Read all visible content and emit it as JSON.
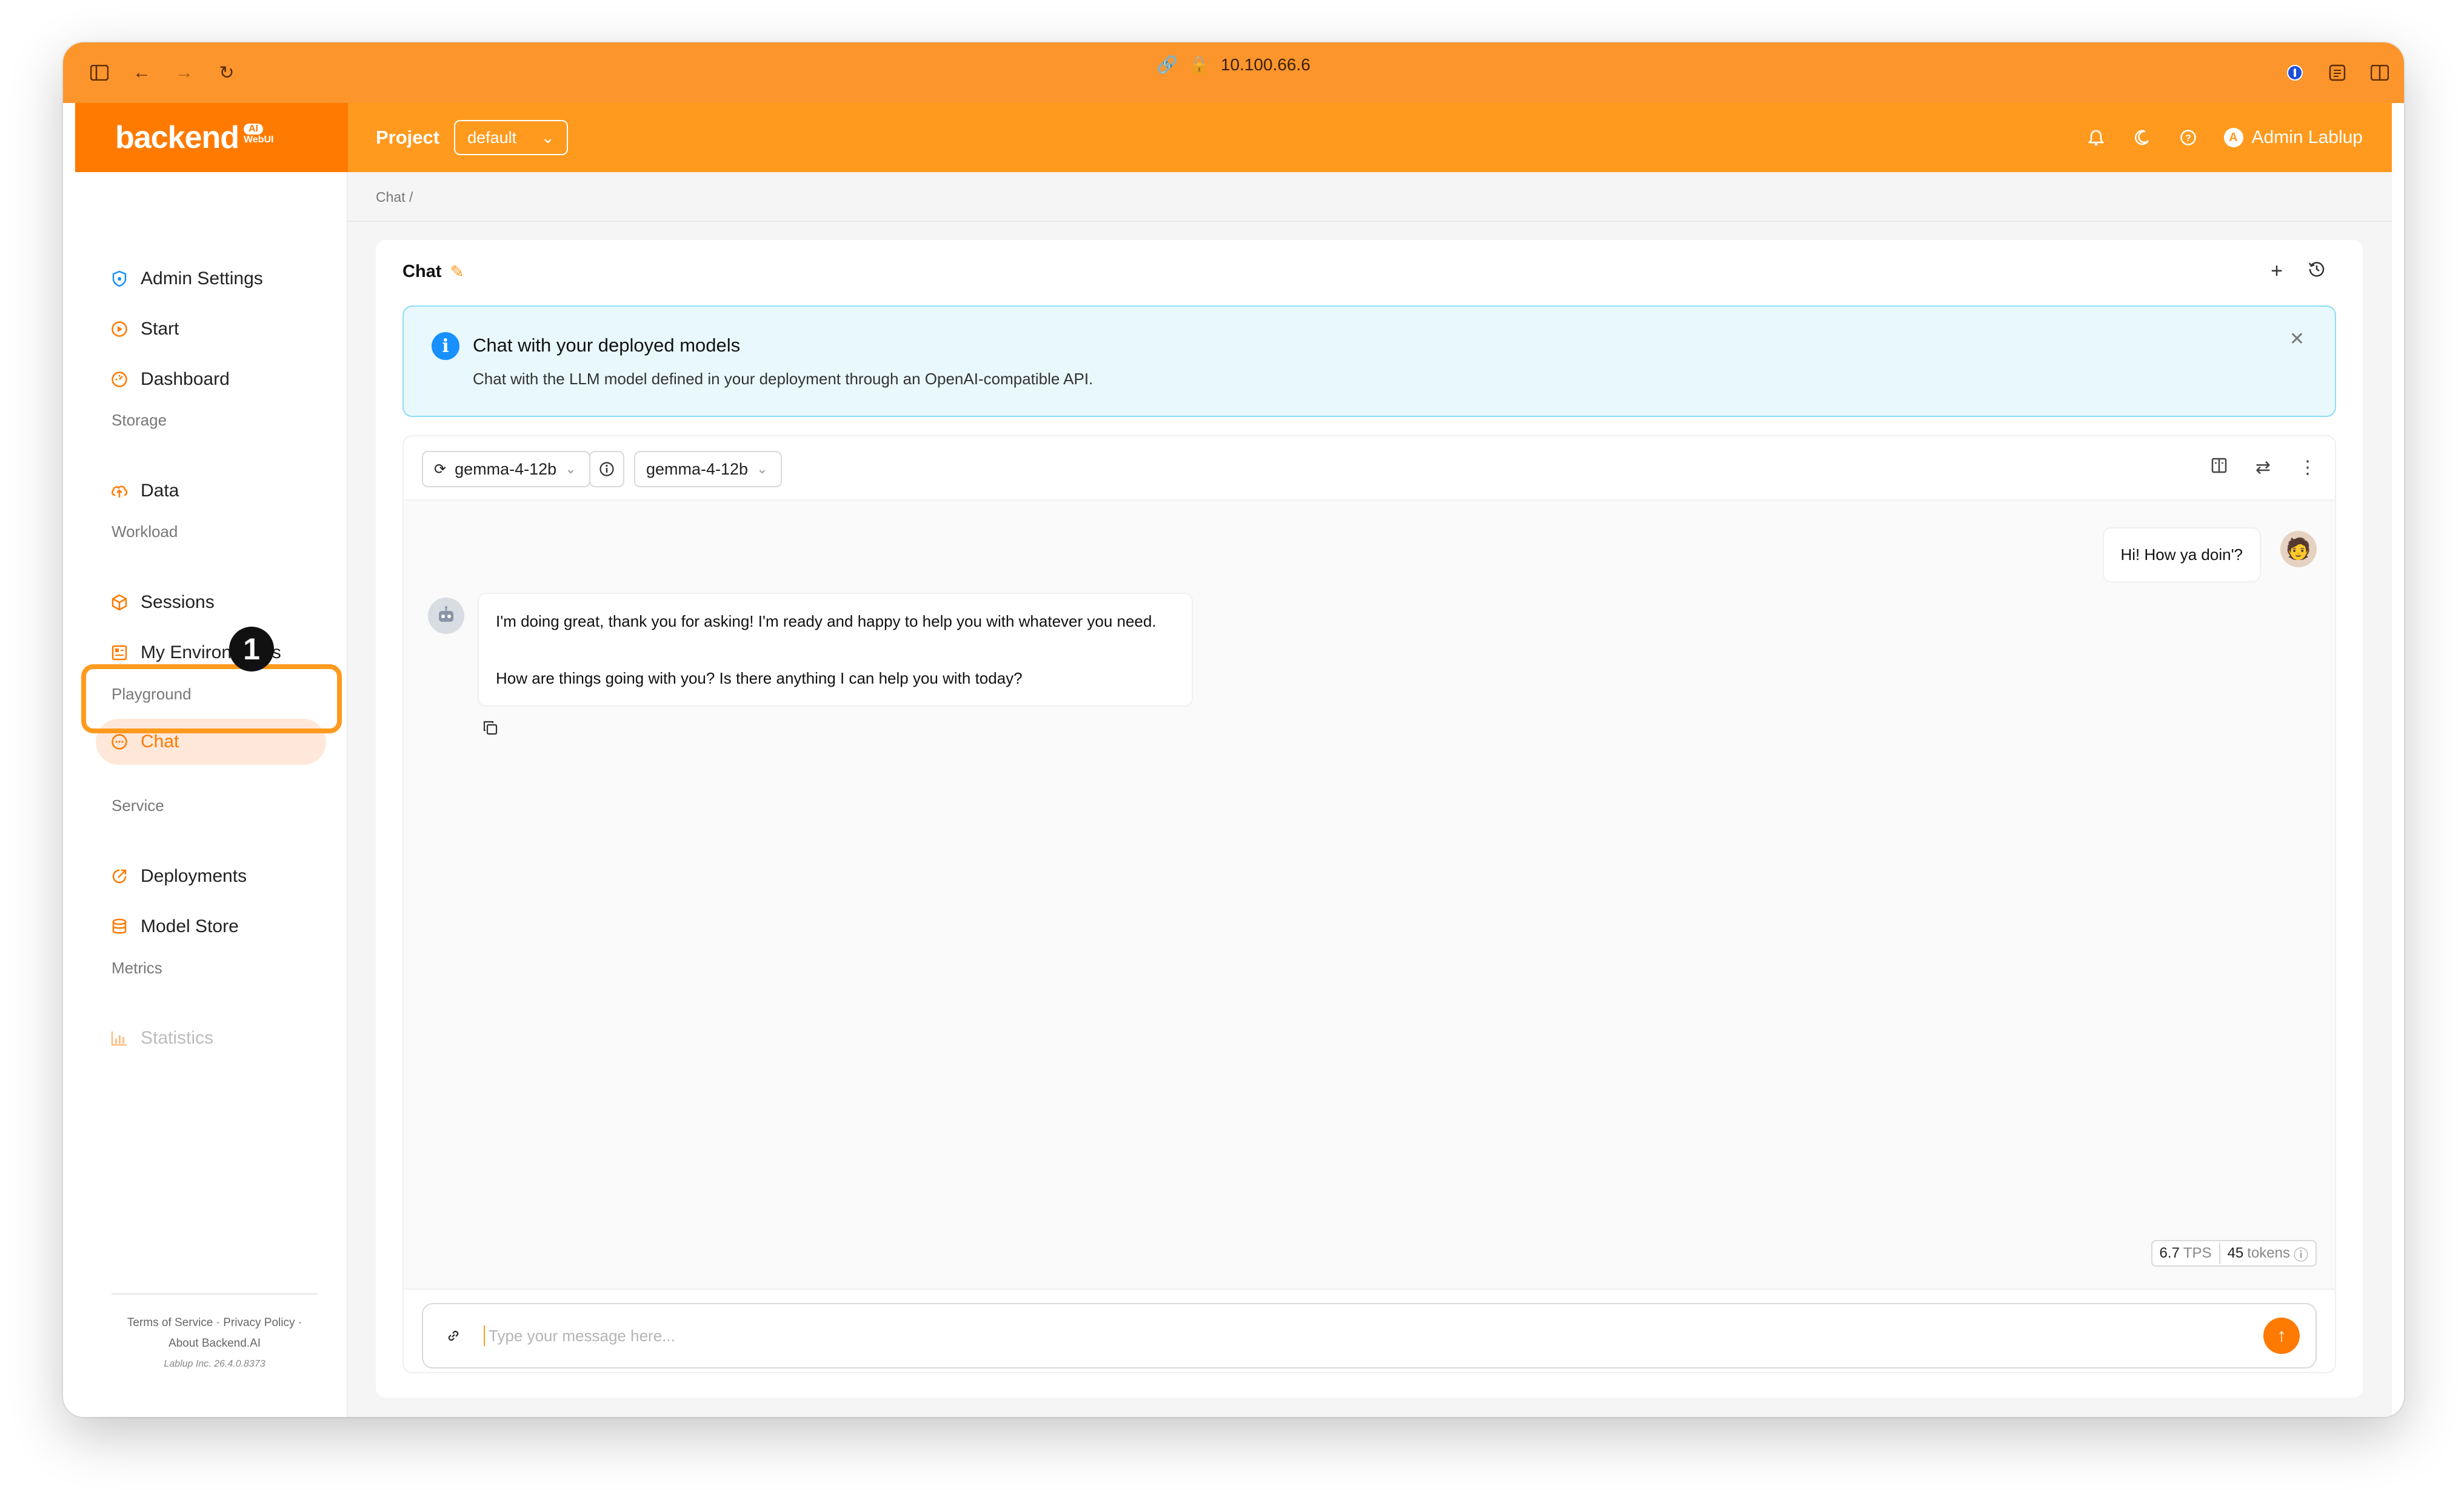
{
  "browser": {
    "url": "10.100.66.6"
  },
  "header": {
    "logo_text": "backend",
    "logo_badge_ai": "AI",
    "logo_badge_webui": "WebUI",
    "project_label": "Project",
    "project_value": "default",
    "user_initial": "A",
    "user_name": "Admin Lablup"
  },
  "sidebar": {
    "items": [
      {
        "label": "Admin Settings",
        "icon": "shield-icon"
      },
      {
        "label": "Start",
        "icon": "play-icon"
      },
      {
        "label": "Dashboard",
        "icon": "dashboard-icon"
      },
      {
        "group": "Storage"
      },
      {
        "label": "Data",
        "icon": "cloud-upload-icon"
      },
      {
        "group": "Workload"
      },
      {
        "label": "Sessions",
        "icon": "cube-icon"
      },
      {
        "label": "My Environments",
        "icon": "environment-icon"
      },
      {
        "group": "Playground"
      },
      {
        "label": "Chat",
        "icon": "chat-icon",
        "active": true
      },
      {
        "group": "Service"
      },
      {
        "label": "Deployments",
        "icon": "deploy-icon"
      },
      {
        "label": "Model Store",
        "icon": "database-icon"
      },
      {
        "group": "Metrics"
      },
      {
        "label": "Statistics",
        "icon": "chart-icon",
        "disabled": true
      }
    ],
    "step_badge": "1",
    "footer": {
      "links": "Terms of Service · Privacy Policy ·",
      "about": "About Backend.AI",
      "version": "Lablup Inc. 26.4.0.8373"
    }
  },
  "main": {
    "breadcrumb": "Chat  /",
    "card_title": "Chat",
    "alert": {
      "title": "Chat with your deployed models",
      "description": "Chat with the LLM model defined in your deployment through an OpenAI-compatible API."
    },
    "endpoint_model": "gemma-4-12b",
    "model": "gemma-4-12b",
    "messages": {
      "user": "Hi! How ya doin'?",
      "assistant_p1": "I'm doing great, thank you for asking! I'm ready and happy to help you with whatever you need.",
      "assistant_p2": "How are things going with you? Is there anything I can help you with today?"
    },
    "stats": {
      "tps_value": "6.7",
      "tps_unit": "TPS",
      "tokens_value": "45",
      "tokens_unit": "tokens"
    },
    "input_placeholder": "Type your message here..."
  },
  "colors": {
    "brand_orange": "#ff7a00",
    "header_orange": "#ff9a1e",
    "info_blue": "#1890ff"
  }
}
